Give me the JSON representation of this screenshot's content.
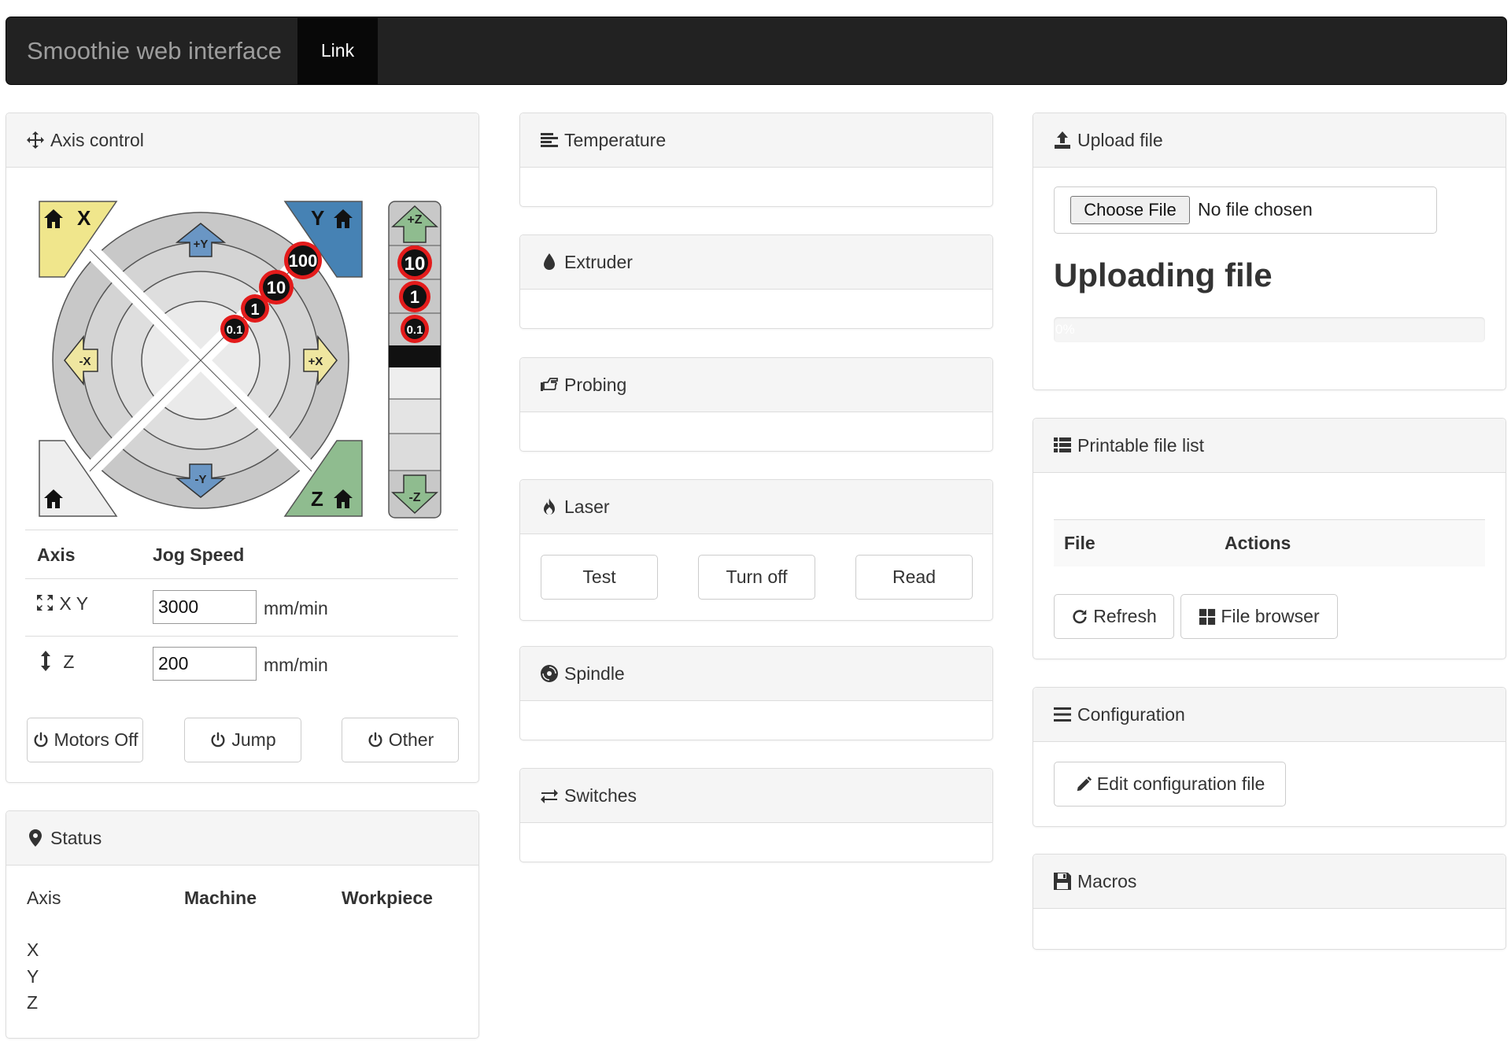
{
  "navbar": {
    "brand": "Smoothie web interface",
    "link": "Link"
  },
  "axis_control": {
    "title": "Axis control",
    "jog": {
      "home_x": "X",
      "home_y": "Y",
      "home_z": "Z",
      "plus_y": "+Y",
      "minus_y": "-Y",
      "plus_x": "+X",
      "minus_x": "-X",
      "plus_z": "+Z",
      "minus_z": "-Z",
      "xy_steps": [
        "100",
        "10",
        "1",
        "0.1"
      ],
      "z_steps": [
        "10",
        "1",
        "0.1"
      ]
    },
    "table": {
      "col_axis": "Axis",
      "col_speed": "Jog Speed",
      "rows": [
        {
          "axis": "X Y",
          "value": "3000",
          "unit": "mm/min"
        },
        {
          "axis": "Z",
          "value": "200",
          "unit": "mm/min"
        }
      ]
    },
    "buttons": {
      "motors_off": "Motors Off",
      "jump": "Jump",
      "other": "Other"
    }
  },
  "status": {
    "title": "Status",
    "cols": [
      "Axis",
      "Machine",
      "Workpiece"
    ],
    "axes": [
      "X",
      "Y",
      "Z"
    ]
  },
  "middle": {
    "temperature": "Temperature",
    "extruder": "Extruder",
    "probing": "Probing",
    "laser": {
      "title": "Laser",
      "test": "Test",
      "turn_off": "Turn off",
      "read": "Read"
    },
    "spindle": "Spindle",
    "switches": "Switches"
  },
  "upload": {
    "title": "Upload file",
    "choose": "Choose File",
    "no_file": "No file chosen",
    "uploading": "Uploading file",
    "progress_label": "0%",
    "progress": 0
  },
  "printable": {
    "title": "Printable file list",
    "col_file": "File",
    "col_actions": "Actions",
    "refresh": "Refresh",
    "browser": "File browser"
  },
  "configuration": {
    "title": "Configuration",
    "edit": "Edit configuration file"
  },
  "macros": {
    "title": "Macros"
  },
  "colors": {
    "home_x": "#f0e68c",
    "home_y": "#4682b4",
    "home_z": "#8fbc8f",
    "step_badge": "#e31b1b"
  }
}
